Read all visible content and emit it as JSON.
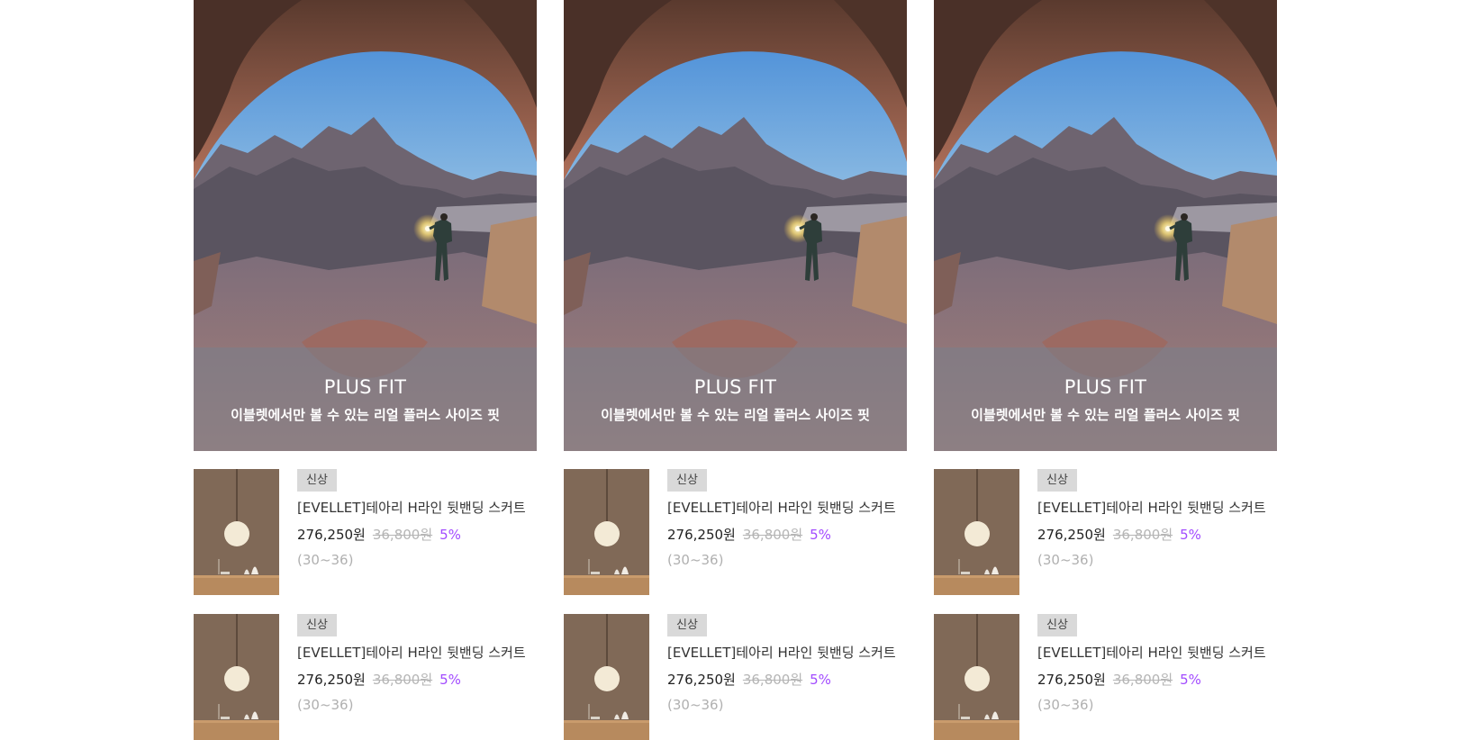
{
  "banner": {
    "title": "PLUS FIT",
    "subtitle": "이블렛에서만 볼 수 있는 리얼 플러스 사이즈 핏"
  },
  "products": [
    {
      "badge": "신상",
      "name": "[EVELLET]테아리 H라인 뒷밴딩 스커트",
      "price": "276,250원",
      "original_price": "36,800원",
      "discount": "5%",
      "size_range": "(30~36)"
    },
    {
      "badge": "신상",
      "name": "[EVELLET]테아리 H라인 뒷밴딩 스커트",
      "price": "276,250원",
      "original_price": "36,800원",
      "discount": "5%",
      "size_range": "(30~36)"
    }
  ],
  "colors": {
    "discount": "#a24bff",
    "badge_bg": "#d9d9d9",
    "original_price": "#b5b5b5"
  }
}
